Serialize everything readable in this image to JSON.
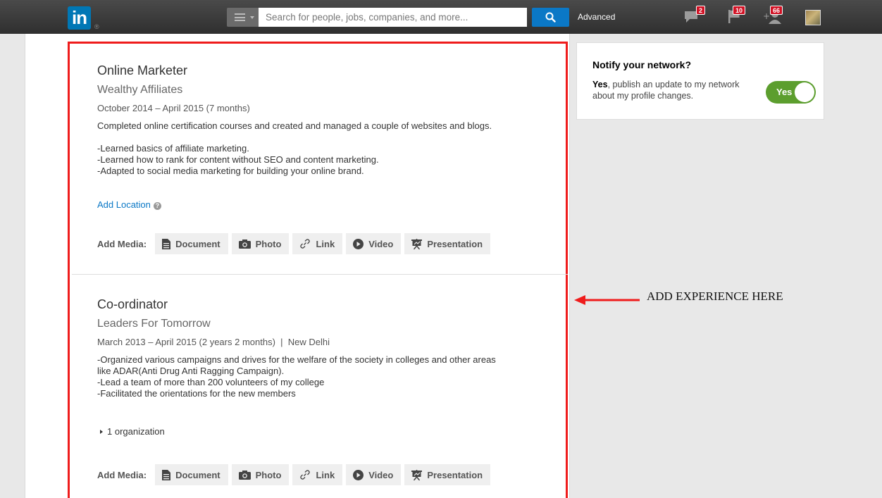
{
  "topbar": {
    "logo_text": "in",
    "search_placeholder": "Search for people, jobs, companies, and more...",
    "advanced_label": "Advanced",
    "messages_badge": "2",
    "notifications_badge": "10",
    "connections_badge": "66"
  },
  "experiences": [
    {
      "title": "Online Marketer",
      "company": "Wealthy Affiliates",
      "dates": "October 2014 – April 2015 (7 months)",
      "description_lines": [
        "Completed online certification courses and created and managed a couple of websites and blogs.",
        "",
        "-Learned basics of affiliate marketing.",
        "-Learned how to rank for content without SEO and content marketing.",
        "-Adapted to social media marketing for building your online brand."
      ],
      "add_location": "Add Location"
    },
    {
      "title": "Co-ordinator",
      "company": "Leaders For Tomorrow",
      "dates": "March 2013 – April 2015 (2 years 2 months)  |  New Delhi",
      "description_lines": [
        "-Organized various campaigns and drives for the welfare of the society in colleges and other areas",
        "like ADAR(Anti Drug Anti Ragging Campaign).",
        "-Lead a team of more than 200 volunteers of my college",
        "-Facilitated the orientations for the new members"
      ],
      "organizations": "1 organization"
    }
  ],
  "media": {
    "label": "Add Media:",
    "document": "Document",
    "photo": "Photo",
    "link": "Link",
    "video": "Video",
    "presentation": "Presentation"
  },
  "notify": {
    "title": "Notify your network?",
    "text_bold": "Yes",
    "text_rest": ", publish an update to my network about my profile changes.",
    "toggle_label": "Yes"
  },
  "annotation": {
    "text": "ADD EXPERIENCE HERE",
    "color": "#ef1c1c"
  },
  "colors": {
    "accent": "#0b78c6",
    "toggle_on": "#5c9e2e",
    "badge": "#d11124"
  }
}
